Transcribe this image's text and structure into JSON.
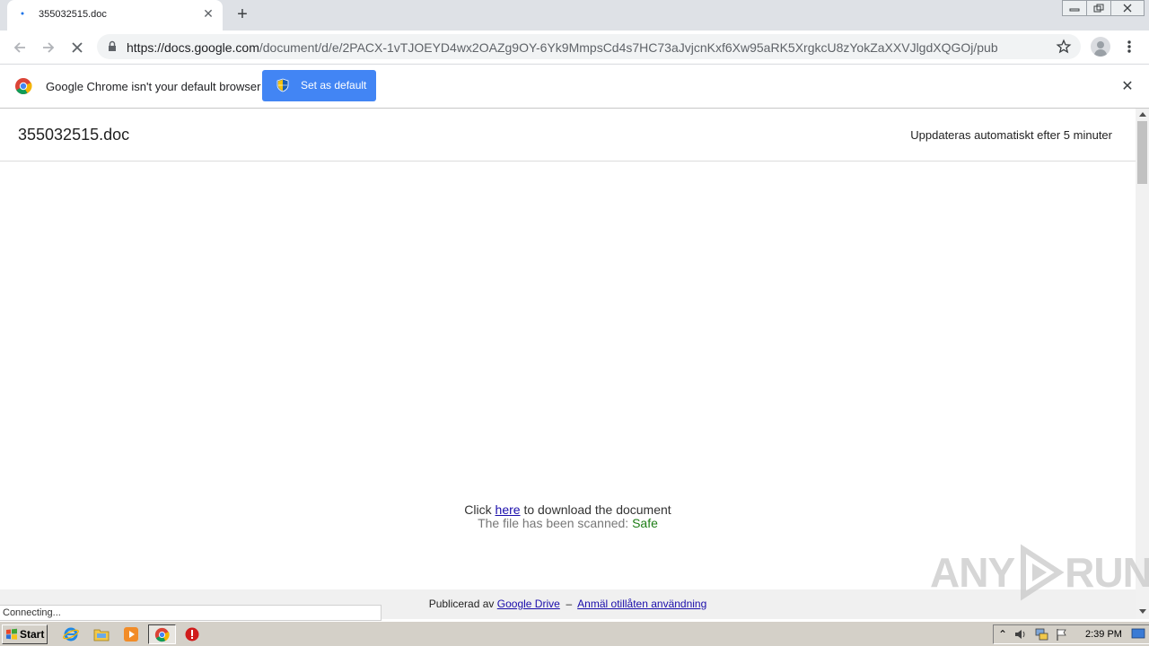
{
  "browser": {
    "tab_title": "355032515.doc",
    "url_host": "https://docs.google.com",
    "url_path": "/document/d/e/2PACX-1vTJOEYD4wx2OAZg9OY-6Yk9MmpsCd4s7HC73aJvjcnKxf6Xw95aRK5XrgkcU8zYokZaXXVJlgdXQGOj/pub",
    "status_text": "Connecting..."
  },
  "infobar": {
    "message": "Google Chrome isn't your default browser",
    "button_label": "Set as default"
  },
  "document": {
    "title": "355032515.doc",
    "auto_update": "Uppdateras automatiskt efter 5 minuter",
    "click_prefix": "Click",
    "click_link": "here",
    "click_suffix": "to download the document",
    "scan_text": "The file has been scanned:",
    "scan_result": "Safe"
  },
  "footer": {
    "published_by": "Publicerad av",
    "drive_link": "Google Drive",
    "separator": "–",
    "report_link": "Anmäl otillåten användning"
  },
  "taskbar": {
    "start_label": "Start",
    "clock": "2:39 PM"
  },
  "watermark": {
    "left": "ANY",
    "right": "RUN"
  },
  "colors": {
    "accent_blue": "#4285f4",
    "link_blue": "#1a0dab",
    "safe_green": "#1e7e16"
  }
}
